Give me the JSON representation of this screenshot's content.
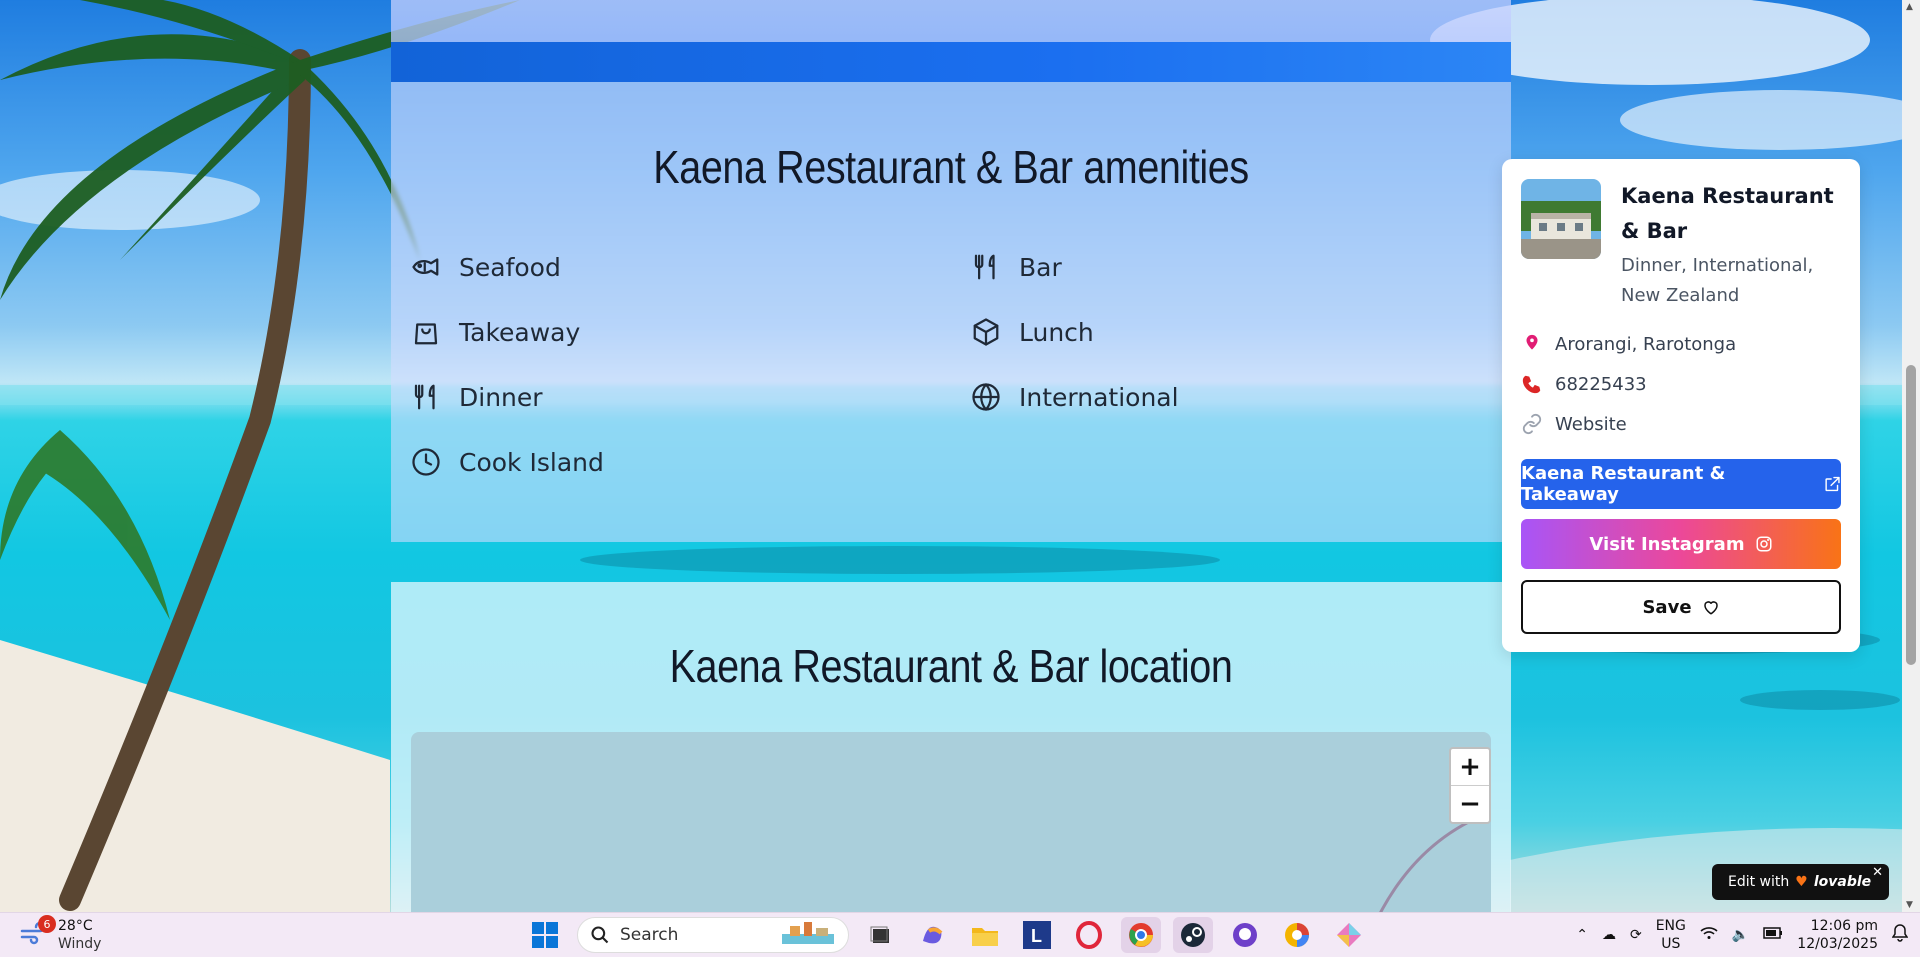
{
  "amenities": {
    "title": "Kaena Restaurant & Bar amenities",
    "items": [
      {
        "label": "Seafood",
        "icon": "fish-icon"
      },
      {
        "label": "Bar",
        "icon": "utensils-icon"
      },
      {
        "label": "Takeaway",
        "icon": "shopping-bag-icon"
      },
      {
        "label": "Lunch",
        "icon": "package-icon"
      },
      {
        "label": "Dinner",
        "icon": "utensils-icon"
      },
      {
        "label": "International",
        "icon": "globe-icon"
      },
      {
        "label": "Cook Island",
        "icon": "clock-icon"
      }
    ]
  },
  "location": {
    "title": "Kaena Restaurant & Bar location",
    "zoom_in": "+",
    "zoom_out": "−"
  },
  "card": {
    "name": "Kaena Restaurant & Bar",
    "categories": "Dinner, International, New Zealand",
    "address": "Arorangi, Rarotonga",
    "phone": "68225433",
    "website": "Website",
    "primary_button": "Kaena Restaurant & Takeaway",
    "instagram_button": "Visit Instagram",
    "save_button": "Save"
  },
  "lovable": {
    "prefix": "Edit with",
    "brand": "lovable",
    "close": "✕"
  },
  "taskbar": {
    "weather_temp": "28°C",
    "weather_cond": "Windy",
    "weather_badge": "6",
    "search_placeholder": "Search",
    "lang_top": "ENG",
    "lang_bottom": "US",
    "time": "12:06 pm",
    "date": "12/03/2025"
  },
  "colors": {
    "primary": "#2563eb",
    "instagram_start": "#a855f7",
    "instagram_end": "#f97316"
  }
}
